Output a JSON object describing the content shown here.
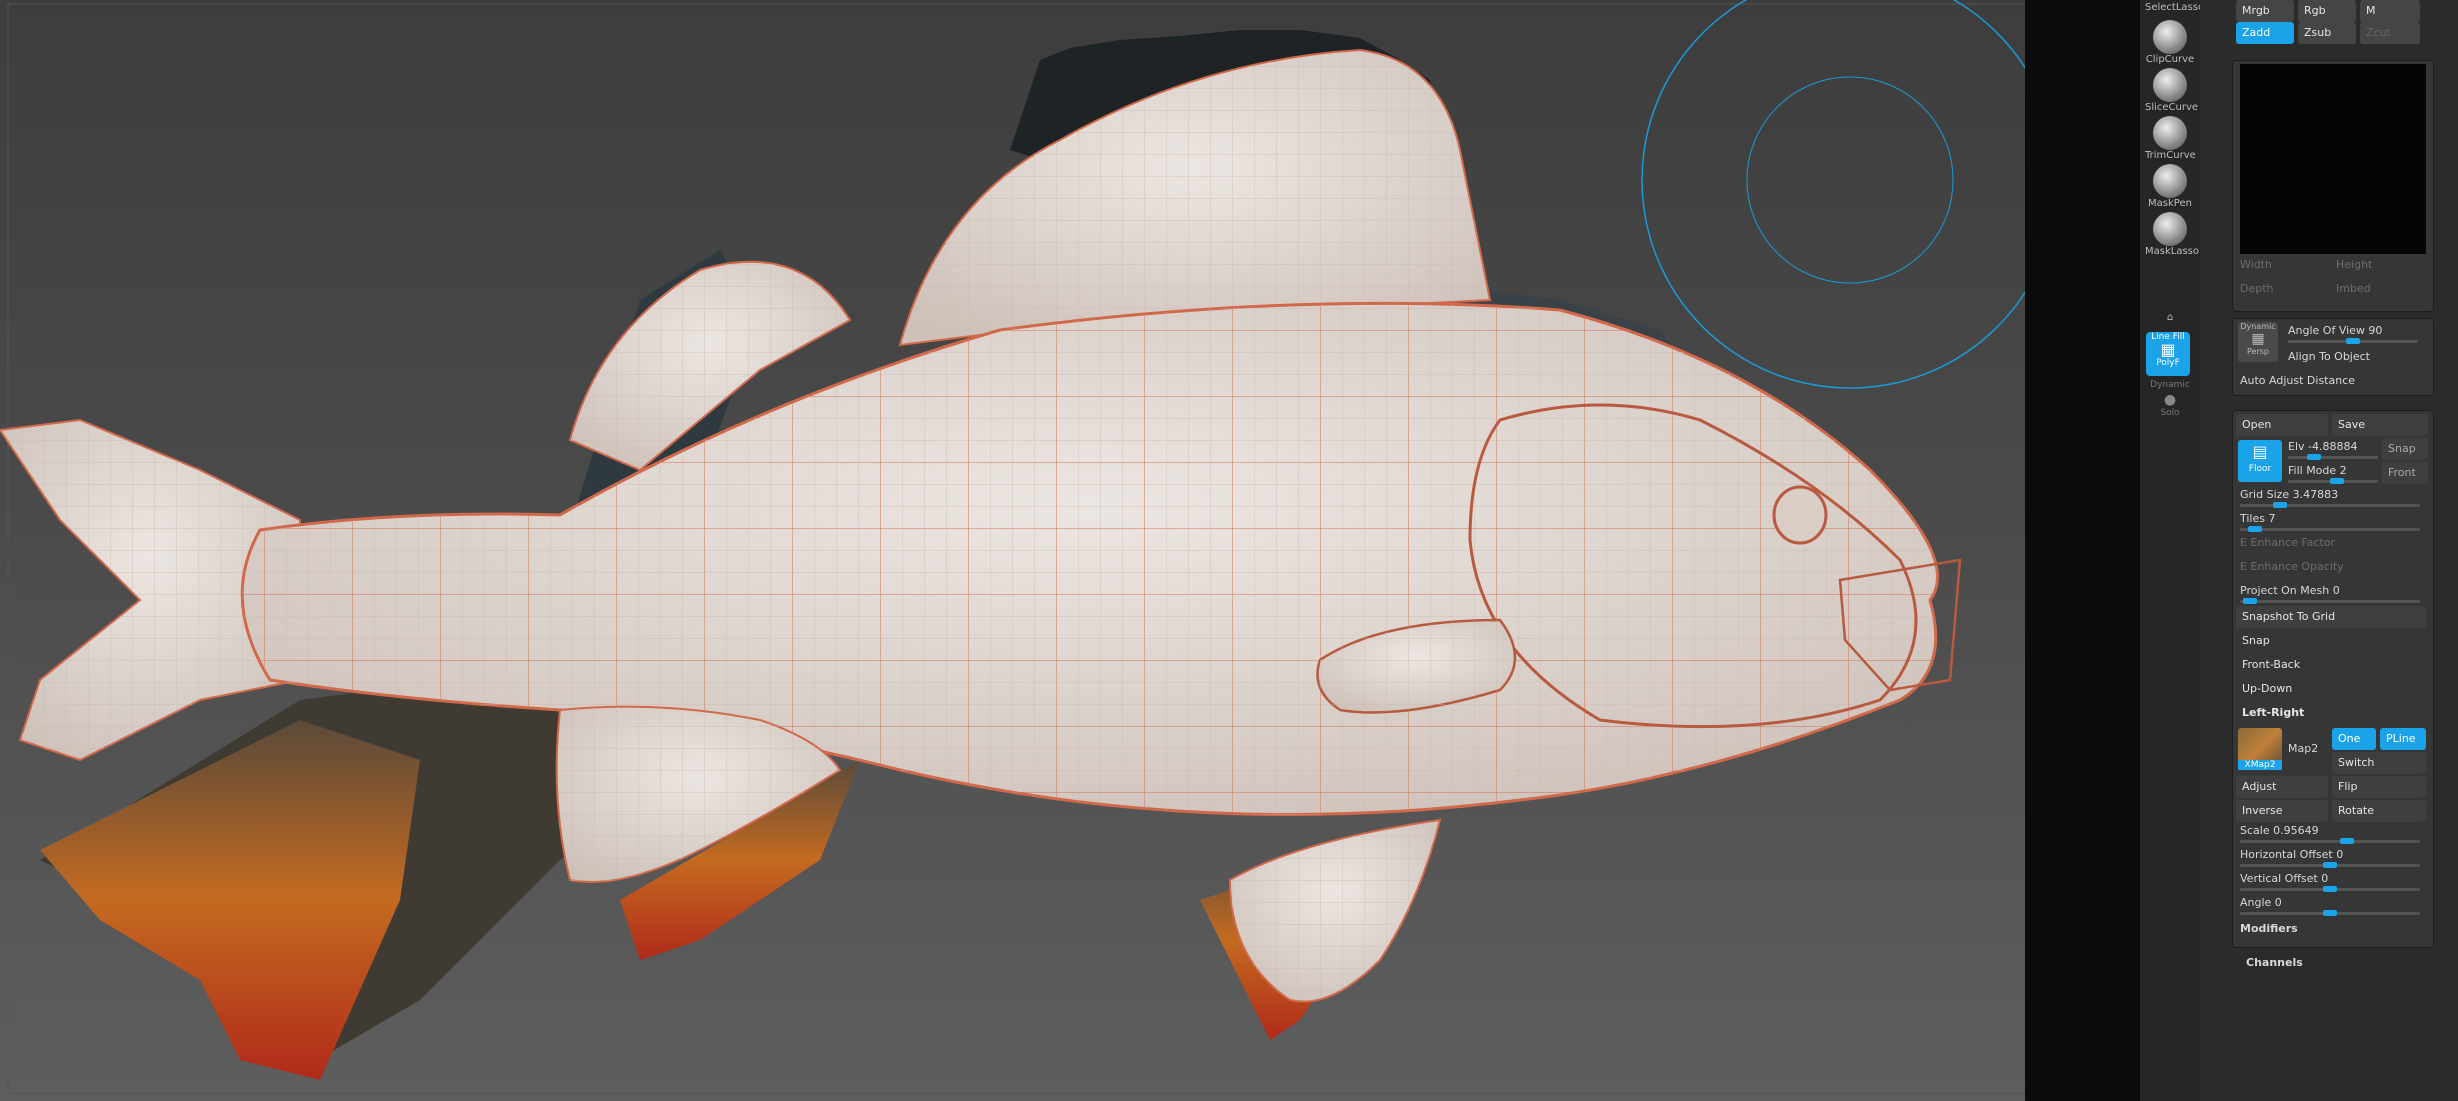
{
  "app": {
    "accent": "#1aa3e8"
  },
  "strip": {
    "tools": [
      {
        "label": "SelectLasso"
      },
      {
        "label": "ClipCurve"
      },
      {
        "label": "SliceCurve"
      },
      {
        "label": "TrimCurve"
      },
      {
        "label": "MaskPen"
      },
      {
        "label": "MaskLasso"
      }
    ],
    "linefill_label": "Line Fill",
    "polyf_label": "PolyF",
    "dynamic_label": "Dynamic",
    "solo_label": "Solo"
  },
  "top": {
    "mrgb": "Mrgb",
    "rgb": "Rgb",
    "m": "M",
    "zadd": "Zadd",
    "zsub": "Zsub",
    "zcut": "Zcut"
  },
  "doc": {
    "width_label": "Width",
    "height_label": "Height",
    "depth_label": "Depth",
    "imbed_label": "Imbed"
  },
  "camera": {
    "persp_top": "Dynamic",
    "persp_bottom": "Persp",
    "angle_of_view": "Angle Of View 90",
    "align_to_object": "Align To Object",
    "auto_adjust_distance": "Auto Adjust Distance"
  },
  "grid": {
    "open": "Open",
    "save": "Save",
    "floor_label": "Floor",
    "elv": "Elv -4.88884",
    "fill_mode": "Fill Mode 2",
    "snap": "Snap",
    "front": "Front",
    "grid_size": "Grid Size 3.47883",
    "tiles": "Tiles 7",
    "enhance_factor": "E Enhance Factor",
    "enhance_opacity": "E Enhance Opacity",
    "project_on_mesh": "Project On Mesh 0",
    "snapshot_to_grid": "Snapshot To Grid",
    "snap_btn": "Snap",
    "front_back": "Front-Back",
    "up_down": "Up-Down",
    "left_right": "Left-Right",
    "map_thumb_label": "XMap2",
    "map2": "Map2",
    "one": "One",
    "pline": "PLine",
    "switch": "Switch",
    "adjust": "Adjust",
    "flip": "Flip",
    "inverse": "Inverse",
    "rotate": "Rotate",
    "scale": "Scale 0.95649",
    "horizontal_offset": "Horizontal Offset 0",
    "vertical_offset": "Vertical Offset 0",
    "angle": "Angle 0",
    "modifiers": "Modifiers",
    "channels": "Channels"
  },
  "sliders": {
    "angle_of_view": 0.5,
    "elv": 0.25,
    "fill_mode": 0.55,
    "grid_size": 0.2,
    "tiles": 0.05,
    "project_on_mesh": 0.02,
    "scale": 0.6,
    "horizontal_offset": 0.5,
    "vertical_offset": 0.5,
    "angle": 0.5
  }
}
